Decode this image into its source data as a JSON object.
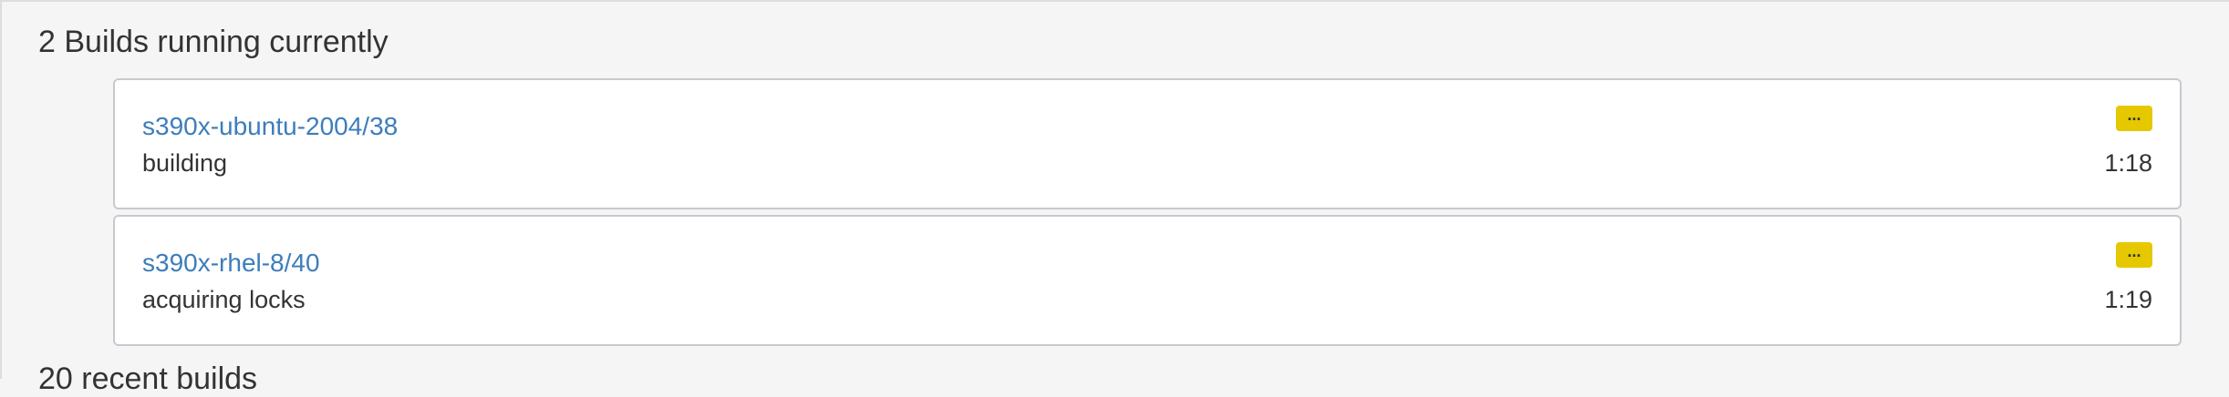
{
  "current_builds": {
    "title": "2 Builds running currently",
    "items": [
      {
        "name": "s390x-ubuntu-2004/38",
        "status": "building",
        "badge": "...",
        "duration": "1:18"
      },
      {
        "name": "s390x-rhel-8/40",
        "status": "acquiring locks",
        "badge": "...",
        "duration": "1:19"
      }
    ]
  },
  "recent_builds": {
    "title": "20 recent builds"
  },
  "colors": {
    "link": "#3d7dbb",
    "badge": "#e6c800",
    "background": "#f5f5f5",
    "card": "#ffffff",
    "card_border": "#c8c8d0"
  }
}
